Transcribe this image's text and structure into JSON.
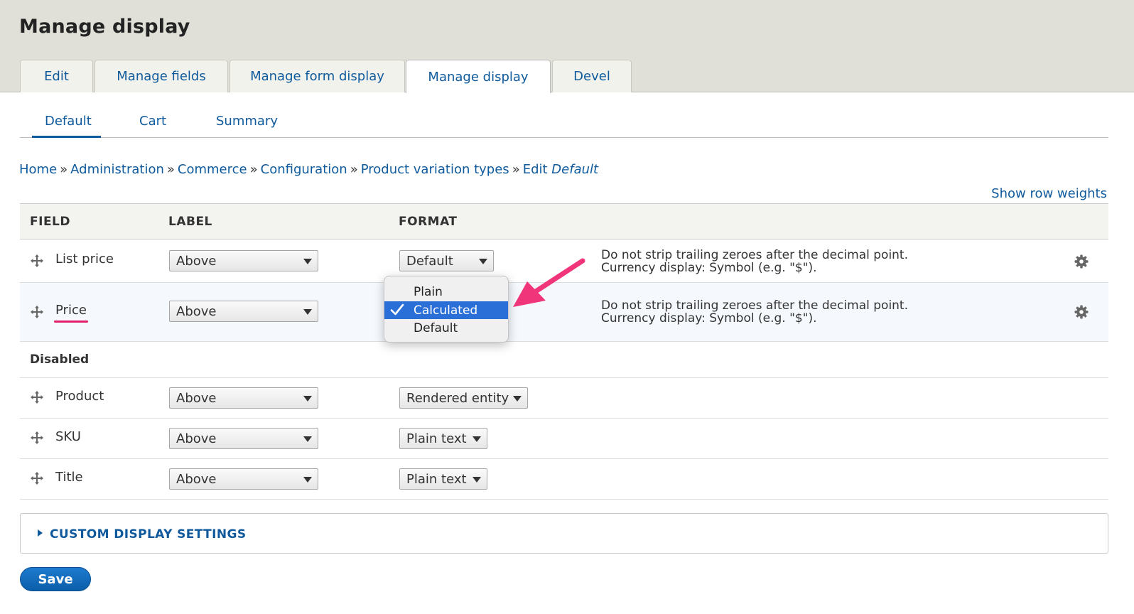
{
  "page": {
    "title": "Manage display"
  },
  "tabs": [
    {
      "label": "Edit"
    },
    {
      "label": "Manage fields"
    },
    {
      "label": "Manage form display"
    },
    {
      "label": "Manage display"
    },
    {
      "label": "Devel"
    }
  ],
  "active_tab": "Manage display",
  "subtabs": [
    {
      "label": "Default"
    },
    {
      "label": "Cart"
    },
    {
      "label": "Summary"
    }
  ],
  "active_subtab": "Default",
  "breadcrumb": {
    "items": [
      "Home",
      "Administration",
      "Commerce",
      "Configuration",
      "Product variation types"
    ],
    "separator": "»",
    "current_prefix": "Edit",
    "current_em": "Default"
  },
  "row_weights_link": "Show row weights",
  "table": {
    "headers": {
      "field": "FIELD",
      "label": "LABEL",
      "format": "FORMAT"
    },
    "rows": [
      {
        "field": "List price",
        "label": "Above",
        "format": "Default",
        "summary": [
          "Do not strip trailing zeroes after the decimal point.",
          "Currency display: Symbol (e.g. \"$\")."
        ]
      },
      {
        "field": "Price",
        "label": "Above",
        "format": "Calculated",
        "summary": [
          "Do not strip trailing zeroes after the decimal point.",
          "Currency display: Symbol (e.g. \"$\")."
        ]
      }
    ],
    "disabled_region": "Disabled",
    "disabled_rows": [
      {
        "field": "Product",
        "label": "Above",
        "format": "Rendered entity"
      },
      {
        "field": "SKU",
        "label": "Above",
        "format": "Plain text"
      },
      {
        "field": "Title",
        "label": "Above",
        "format": "Plain text"
      }
    ]
  },
  "format_dropdown": {
    "options": [
      "Plain",
      "Calculated",
      "Default"
    ],
    "selected": "Calculated"
  },
  "custom_display_settings": "CUSTOM DISPLAY SETTINGS",
  "save_button": "Save",
  "colors": {
    "link": "#0f5a9c",
    "header_bg": "#e0e0d8",
    "selected_option": "#2a6fd8",
    "annotation": "#f0357a"
  },
  "icons": [
    "drag-handle-icon",
    "gear-icon",
    "checkmark-icon",
    "triangle-right-icon",
    "annotation-arrow"
  ]
}
